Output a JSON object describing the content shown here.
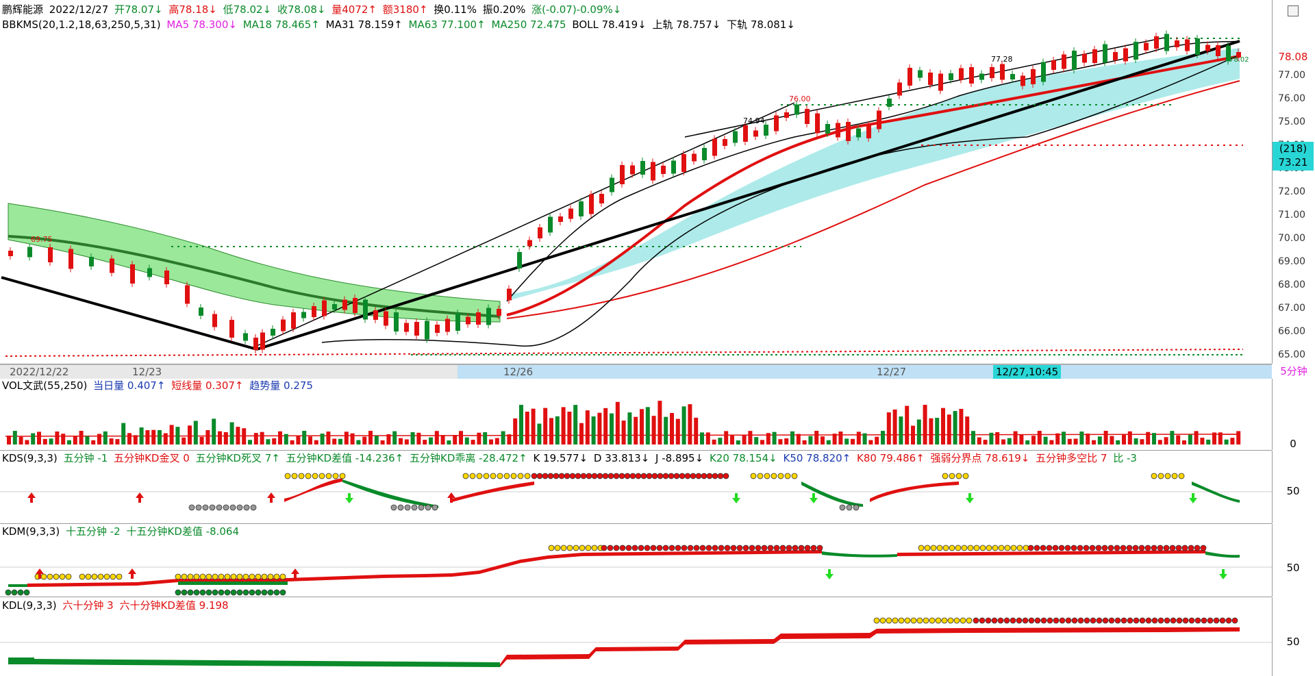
{
  "stock": {
    "name": "鹏辉能源",
    "date": "2022/12/27",
    "open": "开78.07↓",
    "high": "高78.18↓",
    "low": "低78.02↓",
    "close": "收78.08↓",
    "volume": "量4072↑",
    "amount": "额3180↑",
    "turnover": "换0.11%",
    "amplitude": "振0.20%",
    "change": "涨(-0.07)-0.09%↓"
  },
  "indicators": {
    "bbkms": "BBKMS(20,1.2,18,63,250,5,31)",
    "ma5": "MA5 78.300↓",
    "ma18": "MA18 78.465↑",
    "ma31": "MA31 78.159↑",
    "ma63": "MA63 77.100↑",
    "ma250": "MA250 72.475",
    "boll": "BOLL 78.419↓",
    "upper": "上轨 78.757↓",
    "lower": "下轨 78.081↓"
  },
  "price_axis": {
    "ticks": [
      "77.00",
      "76.00",
      "75.00",
      "74.00",
      "73.00",
      "72.00",
      "71.00",
      "70.00",
      "69.00",
      "68.00",
      "67.00",
      "66.00",
      "65.00"
    ],
    "current": "78.08",
    "box_count": "(218)",
    "box_price": "73.21"
  },
  "annotations": {
    "peak1": "74.94",
    "peak2": "76.00",
    "peak3": "77.28",
    "low1": "69.75",
    "last": "78.02"
  },
  "timeline": {
    "labels": [
      "2022/12/22",
      "12/23",
      "12/26",
      "12/27"
    ],
    "cursor": "12/27,10:45",
    "period": "5分钟"
  },
  "vol": {
    "title": "VOL文武(55,250)",
    "today": "当日量 0.407↑",
    "short": "短线量 0.307↑",
    "trend": "趋势量 0.275",
    "axis_zero": "0"
  },
  "kds": {
    "title": "KDS(9,3,3)",
    "items": [
      "五分钟 -1",
      "五分钟KD金叉 0",
      "五分钟KD死叉 7↑",
      "五分钟KD差值 -14.236↑",
      "五分钟KD乖离 -28.472↑"
    ],
    "k": "K 19.577↓",
    "d": "D 33.813↓",
    "j": "J -8.895↓",
    "k20": "K20 78.154↓",
    "k50": "K50 78.820↑",
    "k80": "K80 79.486↑",
    "strong": "强弱分界点 78.619↓",
    "ratio": "五分钟多空比 7",
    "bi": "比 -3",
    "axis": "50"
  },
  "kdm": {
    "title": "KDM(9,3,3)",
    "items": [
      "十五分钟 -2",
      "十五分钟KD差值 -8.064"
    ],
    "axis": "50"
  },
  "kdl": {
    "title": "KDL(9,3,3)",
    "items": [
      "六十分钟 3",
      "六十分钟KD差值 9.198"
    ],
    "axis": "50"
  },
  "colors": {
    "up": "#e01010",
    "down": "#0a8a2a",
    "band": "#aeeaea",
    "green_band": "#9be89b"
  }
}
